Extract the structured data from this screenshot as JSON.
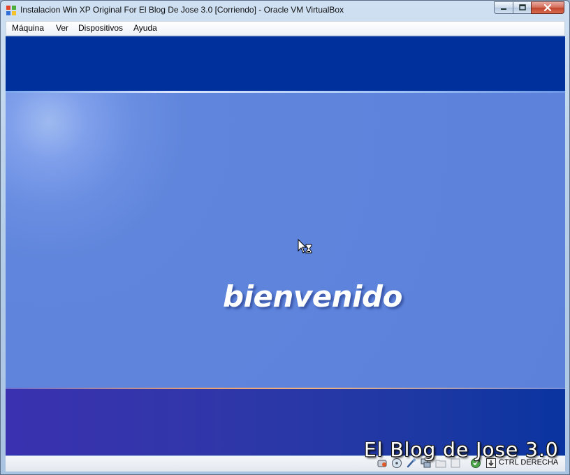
{
  "window": {
    "title": "Instalacion Win XP Original For El Blog De Jose 3.0 [Corriendo] - Oracle VM VirtualBox"
  },
  "menu": {
    "items": [
      {
        "label": "Máquina"
      },
      {
        "label": "Ver"
      },
      {
        "label": "Dispositivos"
      },
      {
        "label": "Ayuda"
      }
    ]
  },
  "guest_screen": {
    "welcome_text": "bienvenido"
  },
  "watermark": {
    "text": "El Blog de Jose 3.0"
  },
  "statusbar": {
    "icons": [
      "hard-disk-icon",
      "optical-drive-icon",
      "usb-icon",
      "network-icon",
      "shared-folders-icon",
      "display-icon",
      "mouse-integration-icon",
      "host-key-icon"
    ],
    "host_key_label": "CTRL DERECHA"
  },
  "colors": {
    "xp_blue_dark": "#00309c",
    "xp_blue_mid": "#5b81db"
  }
}
